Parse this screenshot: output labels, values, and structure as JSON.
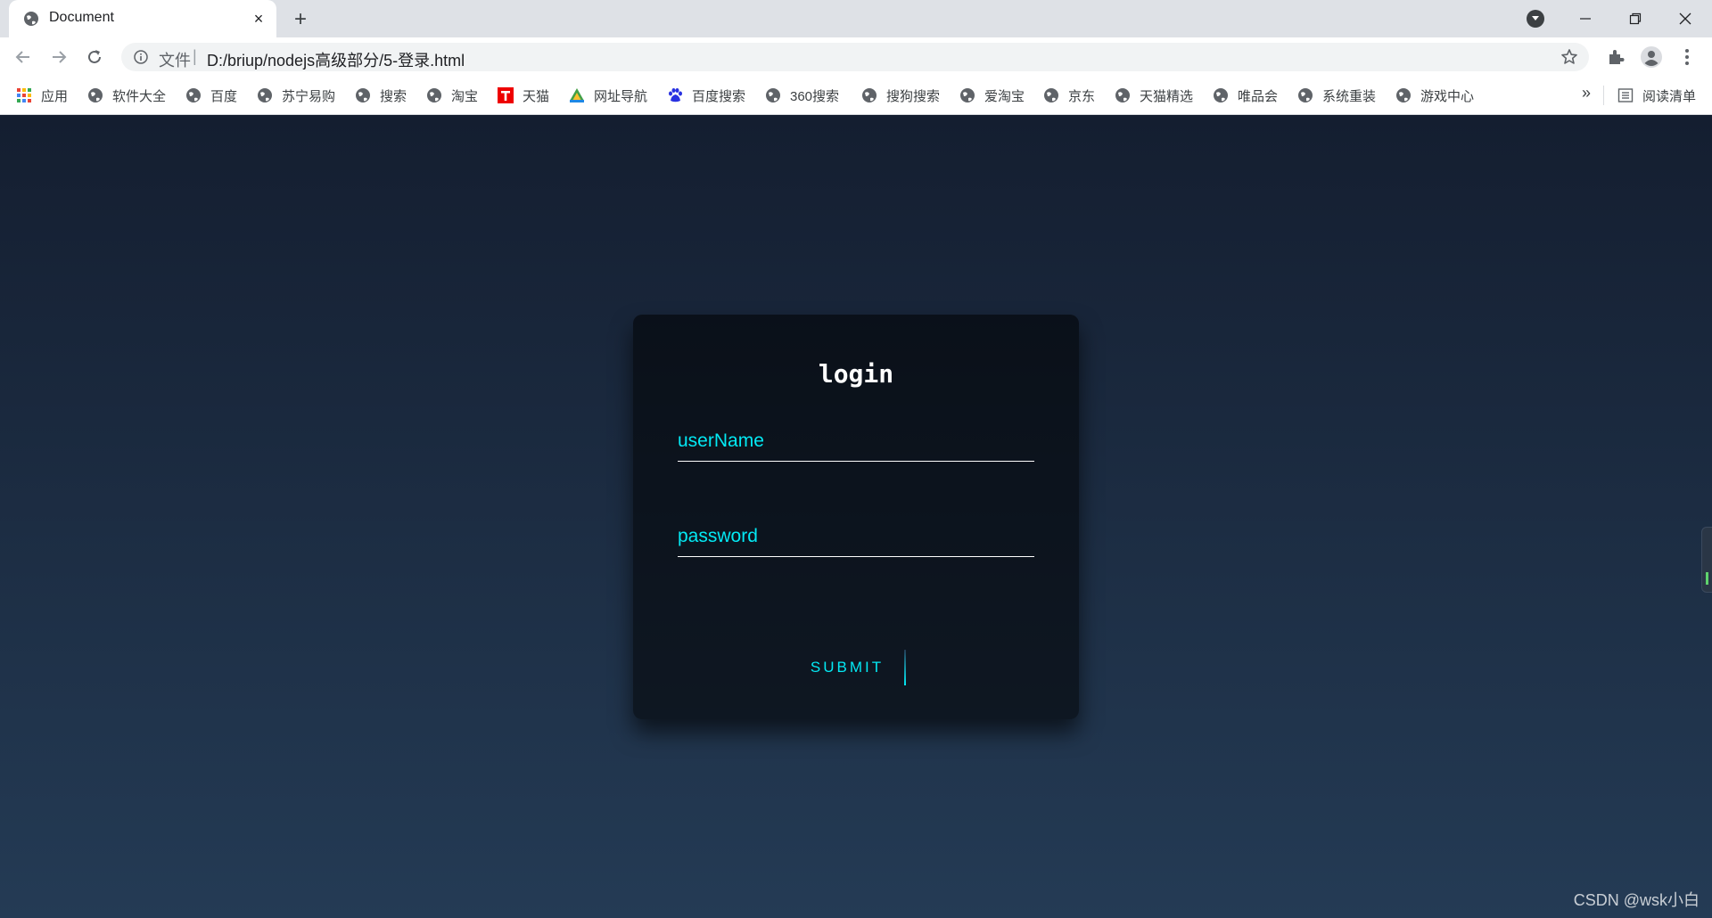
{
  "tab": {
    "title": "Document",
    "close_glyph": "×",
    "favicon": "globe-icon"
  },
  "newtab_glyph": "+",
  "address_bar": {
    "scheme_label": "文件",
    "separator": "|",
    "url": "D:/briup/nodejs高级部分/5-登录.html"
  },
  "bookmarks": [
    {
      "label": "应用",
      "icon": "apps-grid-icon"
    },
    {
      "label": "软件大全",
      "icon": "globe-icon"
    },
    {
      "label": "百度",
      "icon": "globe-icon"
    },
    {
      "label": "苏宁易购",
      "icon": "globe-icon"
    },
    {
      "label": "搜索",
      "icon": "globe-icon"
    },
    {
      "label": "淘宝",
      "icon": "globe-icon"
    },
    {
      "label": "天猫",
      "icon": "tmall-icon"
    },
    {
      "label": "网址导航",
      "icon": "navigation-icon"
    },
    {
      "label": "百度搜索",
      "icon": "baidu-paw-icon"
    },
    {
      "label": "360搜索",
      "icon": "globe-icon"
    },
    {
      "label": "搜狗搜索",
      "icon": "globe-icon"
    },
    {
      "label": "爱淘宝",
      "icon": "globe-icon"
    },
    {
      "label": "京东",
      "icon": "globe-icon"
    },
    {
      "label": "天猫精选",
      "icon": "globe-icon"
    },
    {
      "label": "唯品会",
      "icon": "globe-icon"
    },
    {
      "label": "系统重装",
      "icon": "globe-icon"
    },
    {
      "label": "游戏中心",
      "icon": "globe-icon"
    }
  ],
  "bookmarks_more": "»",
  "reading_list": {
    "label": "阅读清单",
    "icon": "reading-list-icon"
  },
  "login": {
    "title": "login",
    "username_label": "userName",
    "password_label": "password",
    "submit_label": "SUBMIT"
  },
  "watermark": "CSDN @wsk小白",
  "colors": {
    "accent": "#03e9f4",
    "bg_top": "#141e30",
    "bg_bottom": "#243b55"
  }
}
